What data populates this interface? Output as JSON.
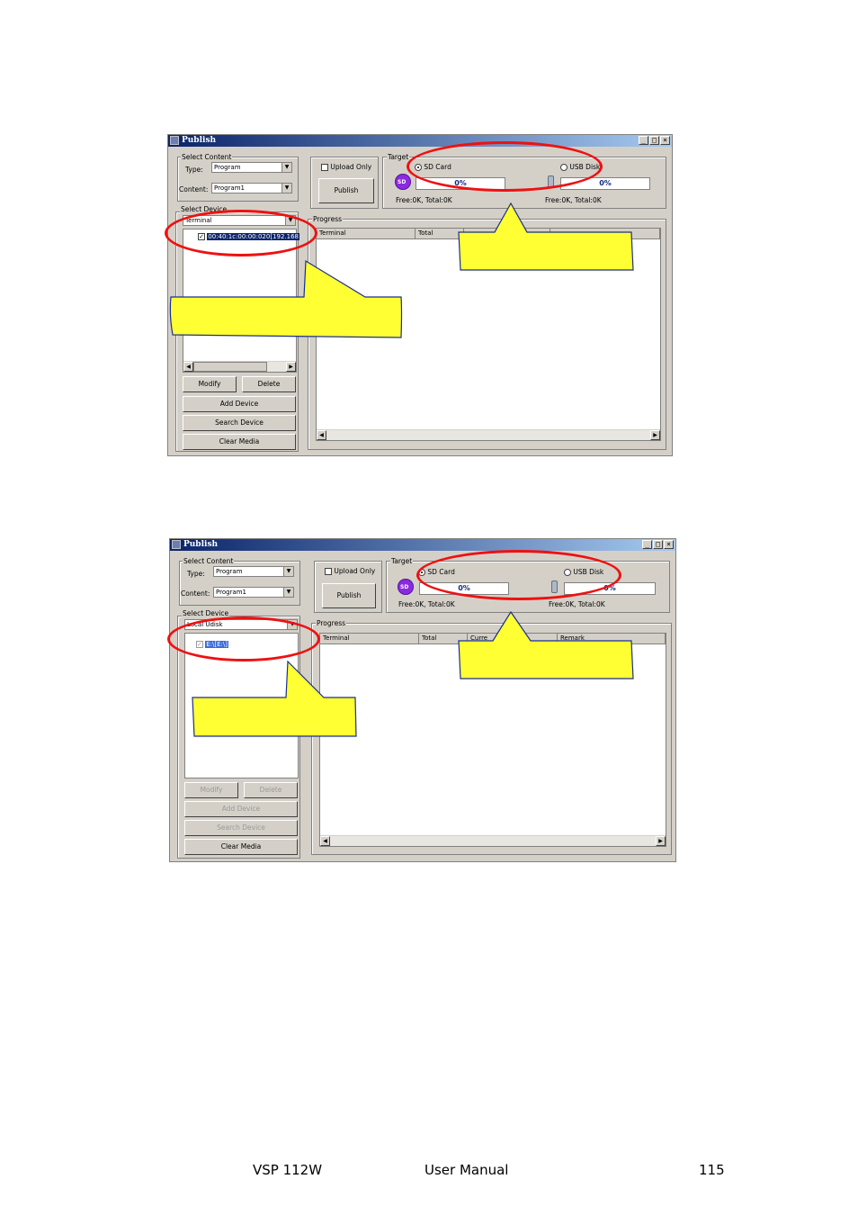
{
  "window_title": "Publish",
  "title_buttons": [
    "_",
    "□",
    "×"
  ],
  "labels": {
    "select_content": "Select Content",
    "type": "Type:",
    "content": "Content:",
    "select_device": "Select Device",
    "upload_only": "Upload Only",
    "publish": "Publish",
    "target": "Target",
    "sd_card": "SD Card",
    "usb_disk": "USB Disk",
    "progress": "Progress",
    "modify": "Modify",
    "delete": "Delete",
    "add_device": "Add Device",
    "search_device": "Search Device",
    "clear_media": "Clear Media"
  },
  "screenshot1": {
    "type_value": "Program",
    "content_value": "Program1",
    "device_type": "Terminal",
    "device_item": "00:40:1c:00:00:020[192.168",
    "sd_percent": "0%",
    "usb_percent": "0%",
    "sd_free": "Free:0K, Total:0K",
    "usb_free": "Free:0K, Total:0K",
    "columns": [
      "Terminal",
      "Total",
      "",
      ""
    ]
  },
  "screenshot2": {
    "type_value": "Program",
    "content_value": "Program1",
    "device_type": "Local Udisk",
    "device_item": "E:\\[E:\\]",
    "sd_percent": "0%",
    "usb_percent": "0%",
    "sd_free": "Free:0K, Total:0K",
    "usb_free": "Free:0K, Total:0K",
    "columns": [
      "Terminal",
      "Total",
      "Curre",
      "Remark"
    ]
  },
  "footer": {
    "model": "VSP 112W",
    "doc": "User Manual",
    "page": "115"
  },
  "colors": {
    "highlight_ring": "#ee1111",
    "callout_fill": "#ffff33",
    "callout_border": "#1a2f8a",
    "titlebar": "#0a246a",
    "window_face": "#d4d0c8"
  }
}
